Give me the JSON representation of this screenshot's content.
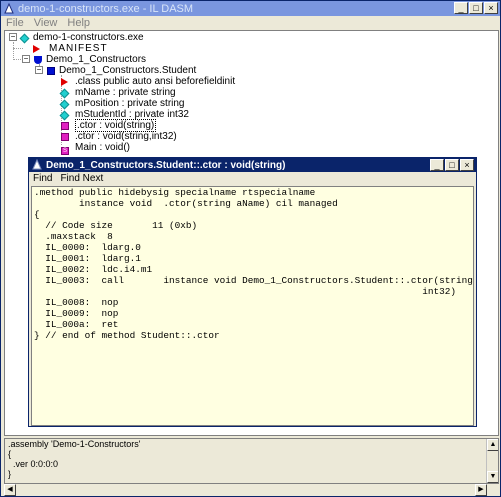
{
  "window": {
    "title": "demo-1-constructors.exe - IL DASM",
    "buttons": [
      "_",
      "□",
      "×"
    ]
  },
  "menu": [
    "File",
    "View",
    "Help"
  ],
  "tree": {
    "root": "demo-1-constructors.exe",
    "manifest": "MANIFEST",
    "namespace": "Demo_1_Constructors",
    "class": "Demo_1_Constructors.Student",
    "members": [
      {
        "icon": "red-triangle-icon",
        "label": ".class public auto ansi beforefieldinit"
      },
      {
        "icon": "field-diamond-icon",
        "label": "mName : private string"
      },
      {
        "icon": "field-diamond-icon",
        "label": "mPosition : private string"
      },
      {
        "icon": "field-diamond-icon",
        "label": "mStudentId : private int32"
      },
      {
        "icon": "method-icon",
        "label": ".ctor : void(string)"
      },
      {
        "icon": "method-icon",
        "label": ".ctor : void(string,int32)"
      },
      {
        "icon": "static-method-icon",
        "label": "Main : void()"
      }
    ]
  },
  "child_window": {
    "title": "Demo_1_Constructors.Student::.ctor : void(string)",
    "menu": [
      "Find",
      "Find Next"
    ],
    "code": ".method public hidebysig specialname rtspecialname\n        instance void  .ctor(string aName) cil managed\n{\n  // Code size       11 (0xb)\n  .maxstack  8\n  IL_0000:  ldarg.0\n  IL_0001:  ldarg.1\n  IL_0002:  ldc.i4.m1\n  IL_0003:  call       instance void Demo_1_Constructors.Student::.ctor(string,\n                                                                     int32)\n  IL_0008:  nop\n  IL_0009:  nop\n  IL_000a:  ret\n} // end of method Student::.ctor"
  },
  "bottom_panel": {
    "text": ".assembly 'Demo-1-Constructors'\n{\n  .ver 0:0:0:0\n}"
  },
  "colors": {
    "title_active": "#0a246a",
    "title_inactive": "#7a96df",
    "code_bg": "#ffffe1"
  }
}
